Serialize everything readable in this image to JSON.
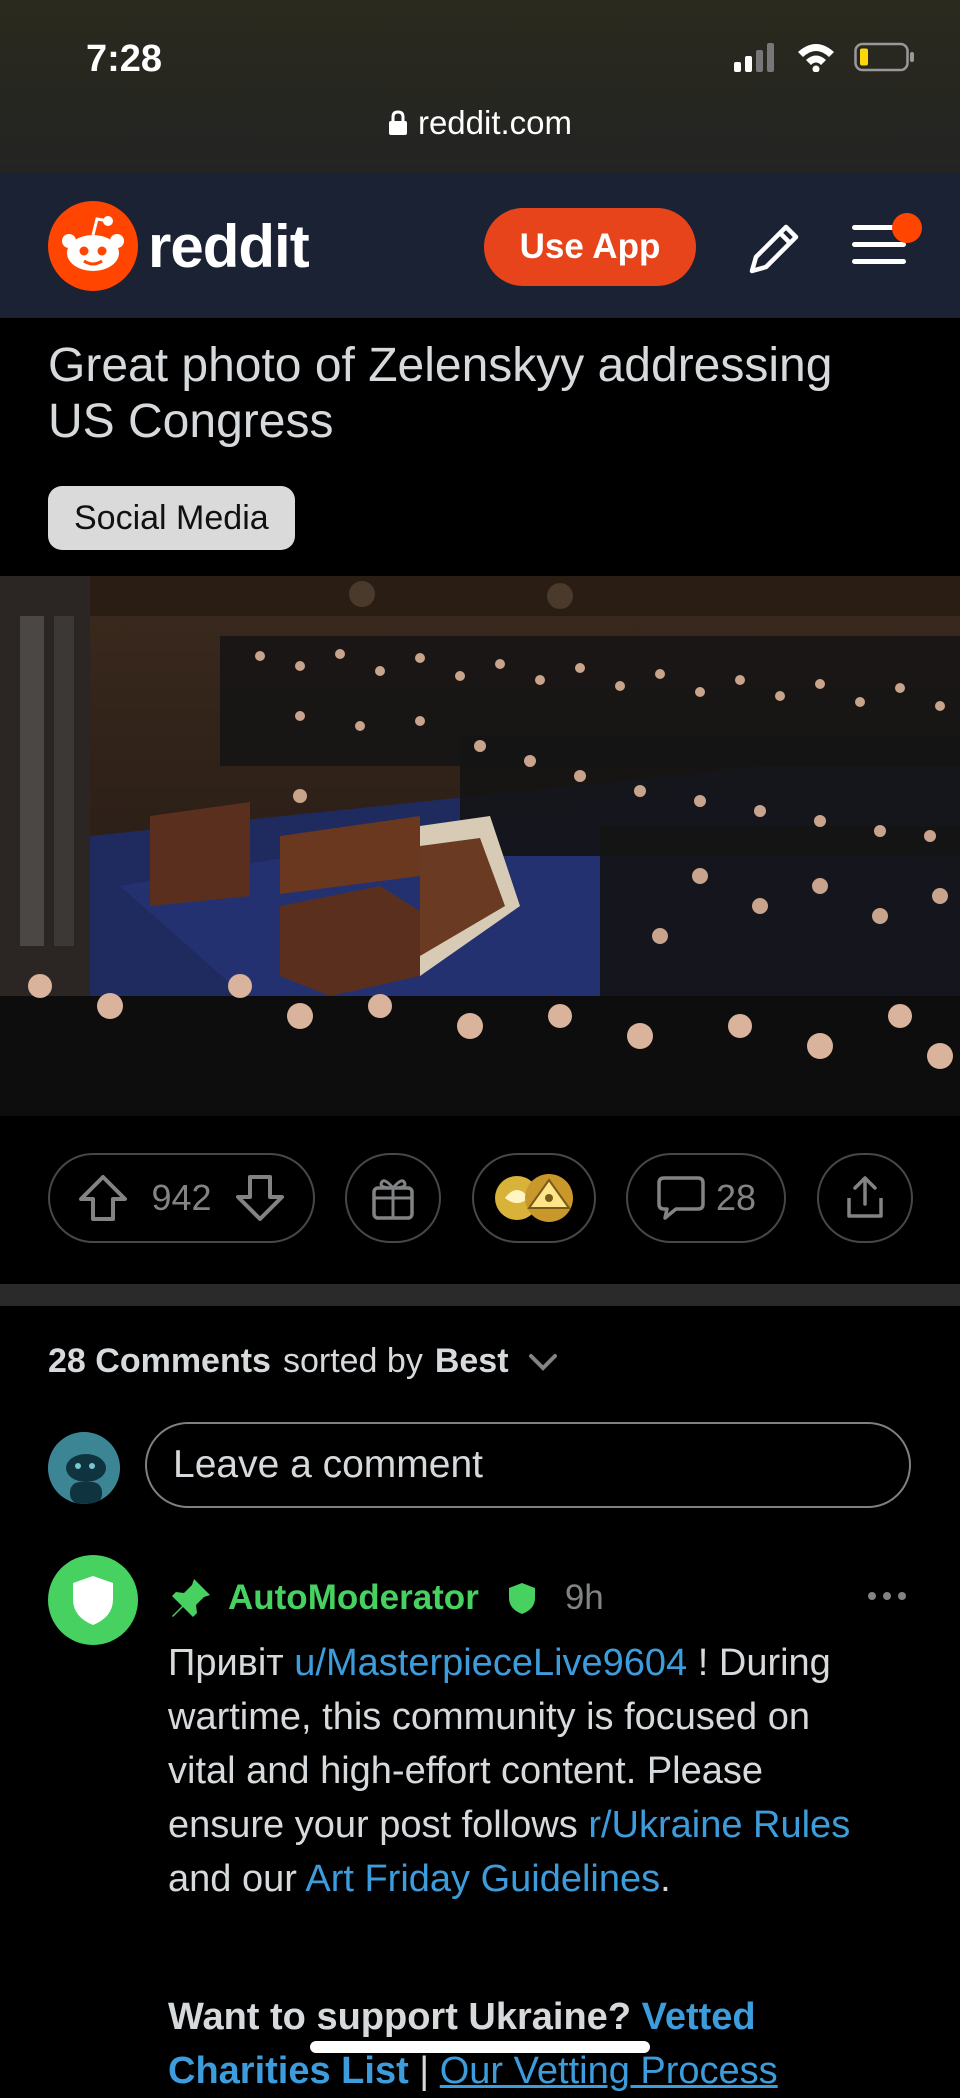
{
  "status": {
    "time": "7:28",
    "url": "reddit.com"
  },
  "header": {
    "logo_text": "reddit",
    "use_app": "Use App"
  },
  "post": {
    "title": "Great photo of Zelenskyy addressing US Congress",
    "flair": "Social Media",
    "votes": "942",
    "comments_count": "28"
  },
  "comments_section": {
    "count_label": "28 Comments",
    "sorted_by": "sorted by",
    "sort_value": "Best",
    "input_placeholder": "Leave a comment"
  },
  "mod_comment": {
    "author": "AutoModerator",
    "time": "9h",
    "greeting": "Привіт",
    "user_link": "u/MasterpieceLive9604",
    "after_user": " ! During wartime, this community is focused on vital and high-effort content. Please ensure your post follows ",
    "rules_link": "r/Ukraine Rules",
    "and_our": " and our ",
    "guidelines_link": "Art Friday Guidelines",
    "period": ".",
    "support_text": "Want to support Ukraine?",
    "charities_link": "Vetted Charities List",
    "sep": " | ",
    "vetting_link": "Our Vetting Process"
  },
  "icons": [
    "lock-icon",
    "signal-icon",
    "wifi-icon",
    "battery-icon",
    "reddit-logo-icon",
    "pencil-icon",
    "menu-icon",
    "upvote-icon",
    "downvote-icon",
    "gift-icon",
    "award-icon",
    "comment-icon",
    "share-icon",
    "chevron-down-icon",
    "shield-icon",
    "pin-icon",
    "more-icon"
  ]
}
